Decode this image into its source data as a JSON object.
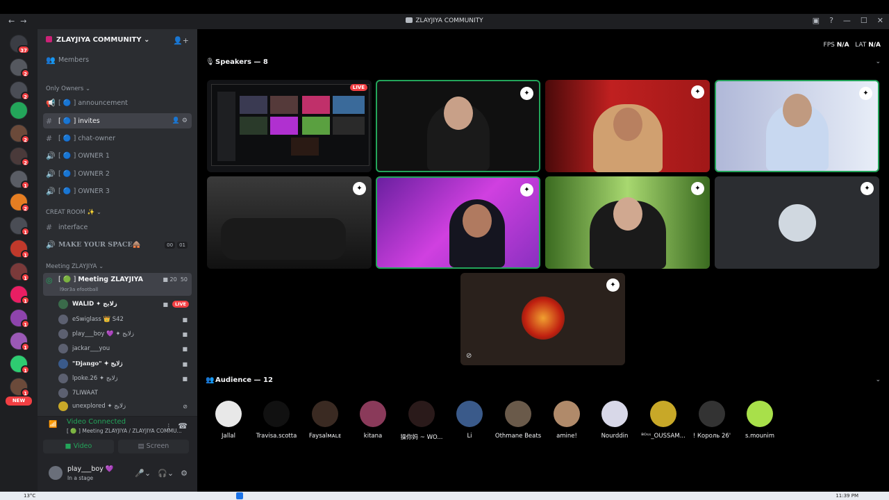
{
  "window": {
    "title": "ZLAYJIYA COMMUNITY"
  },
  "server": {
    "name": "ZLAYJIYA COMMUNITY",
    "members_label": "Members"
  },
  "guild_badges": [
    "37",
    "2",
    "2",
    "",
    "2",
    "2",
    "1",
    "2",
    "1",
    "1",
    "1",
    "1",
    "1",
    "1",
    "1",
    "1"
  ],
  "new_label": "NEW",
  "categories": {
    "only_owners": "Only Owners",
    "creat_room": "CREAT ROOM ✨",
    "meeting": "Meeting ZLAYJIYA"
  },
  "channels": [
    {
      "name": "announcement",
      "prefix": "[ 🔵 ]"
    },
    {
      "name": "invites",
      "prefix": "[ 🔵 ]"
    },
    {
      "name": "chat-owner",
      "prefix": "[ 🔵 ]"
    },
    {
      "name": "OWNER 1",
      "prefix": "[ 🔵 ]"
    },
    {
      "name": "OWNER 2",
      "prefix": "[ 🔵 ]"
    },
    {
      "name": "OWNER 3",
      "prefix": "[ 🔵 ]"
    },
    {
      "name": "interface"
    },
    {
      "name": "MAKE YOUR SPACE🛖",
      "pill_a": "00",
      "pill_b": "01"
    }
  ],
  "meeting_channel": {
    "name": "Meeting ZLAYJIYA",
    "prefix": "[ 🟢 ]",
    "topic": "l9or3a efootball",
    "count_a": "20",
    "count_b": "50"
  },
  "voice_users": [
    {
      "name": "WALID ✦ زلايج",
      "live": "LIVE"
    },
    {
      "name": "eSwiglass 👑 S42"
    },
    {
      "name": "play___boy 💜 ✦ زلايج"
    },
    {
      "name": "jackar___you"
    },
    {
      "name": "\"Django\" ✦ زلايج"
    },
    {
      "name": "lpoke.26 ✦ زلايج"
    },
    {
      "name": "7LIWAAT"
    },
    {
      "name": "unexplored ✦ زلايج"
    }
  ],
  "voice_connection": {
    "status": "Video Connected",
    "channel": "[ 🟢 ] Meeting ZLAYJIYA / ZLAYJIYA COMMU...",
    "video_label": "Video",
    "screen_label": "Screen"
  },
  "user": {
    "name": "play___boy 💜",
    "status": "In a stage"
  },
  "stats": {
    "fps_label": "FPS",
    "fps_value": "N/A",
    "lat_label": "LAT",
    "lat_value": "N/A"
  },
  "speakers_header": "Speakers — 8",
  "audience_header": "Audience — 12",
  "stream_live": "LIVE",
  "audience": [
    {
      "name": "Jallal",
      "color": "#e8e8e8"
    },
    {
      "name": "Travisa.scotta",
      "color": "#111111"
    },
    {
      "name": "Faysalᴍᴀʟᴇ",
      "color": "#3a2a22"
    },
    {
      "name": "kitana",
      "color": "#8a3a5a"
    },
    {
      "name": "操你妈 ~ WO...",
      "color": "#2a1a1a"
    },
    {
      "name": "Li",
      "color": "#3a5a8a"
    },
    {
      "name": "Othmane Beats",
      "color": "#6a5a4a"
    },
    {
      "name": "amine!",
      "color": "#b08a6a"
    },
    {
      "name": "Nourddin",
      "color": "#d8d8e8"
    },
    {
      "name": "ᴮᴼˢˢ_OUSSAM...",
      "color": "#c8a828"
    },
    {
      "name": "! Король 26'",
      "color": "#333333"
    },
    {
      "name": "s.mounim",
      "color": "#a8e04a"
    }
  ],
  "taskbar": {
    "weather": "13°C",
    "clock": "11:39 PM"
  }
}
